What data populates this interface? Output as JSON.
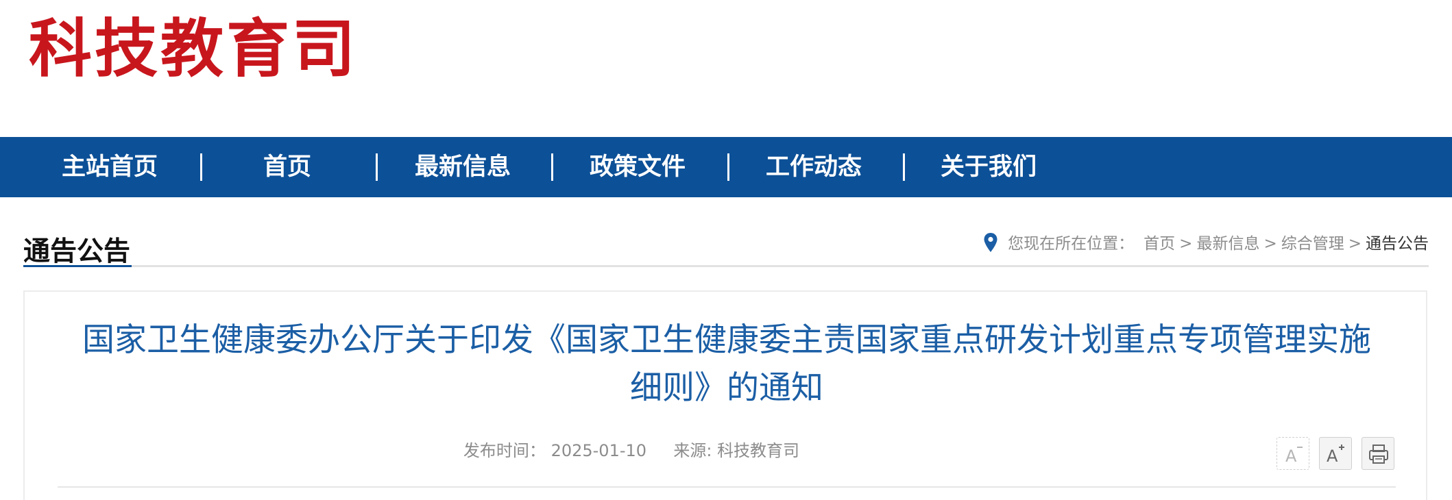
{
  "header": {
    "logo_text": "科技教育司"
  },
  "nav": {
    "items": [
      {
        "label": "主站首页"
      },
      {
        "label": "首页"
      },
      {
        "label": "最新信息"
      },
      {
        "label": "政策文件"
      },
      {
        "label": "工作动态"
      },
      {
        "label": "关于我们"
      }
    ],
    "separator": "|"
  },
  "section": {
    "title": "通告公告"
  },
  "breadcrumb": {
    "icon": "location-pin-icon",
    "label": "您现在所在位置：",
    "items": [
      "首页",
      "最新信息",
      "综合管理",
      "通告公告"
    ],
    "separator": ">"
  },
  "article": {
    "title_line1": "国家卫生健康委办公厅关于印发《国家卫生健康委主责国家重点研发计划重点专项管理实施",
    "title_line2": "细则》的通知",
    "date_label": "发布时间：",
    "date": "2025-01-10",
    "source_label": "来源:",
    "source": "科技教育司"
  },
  "tools": {
    "font_decrease": "font-decrease-icon",
    "font_increase": "font-increase-icon",
    "print": "print-icon"
  },
  "colors": {
    "brand_red": "#c8161d",
    "nav_blue": "#0c5097",
    "title_blue": "#1b5ea5"
  }
}
